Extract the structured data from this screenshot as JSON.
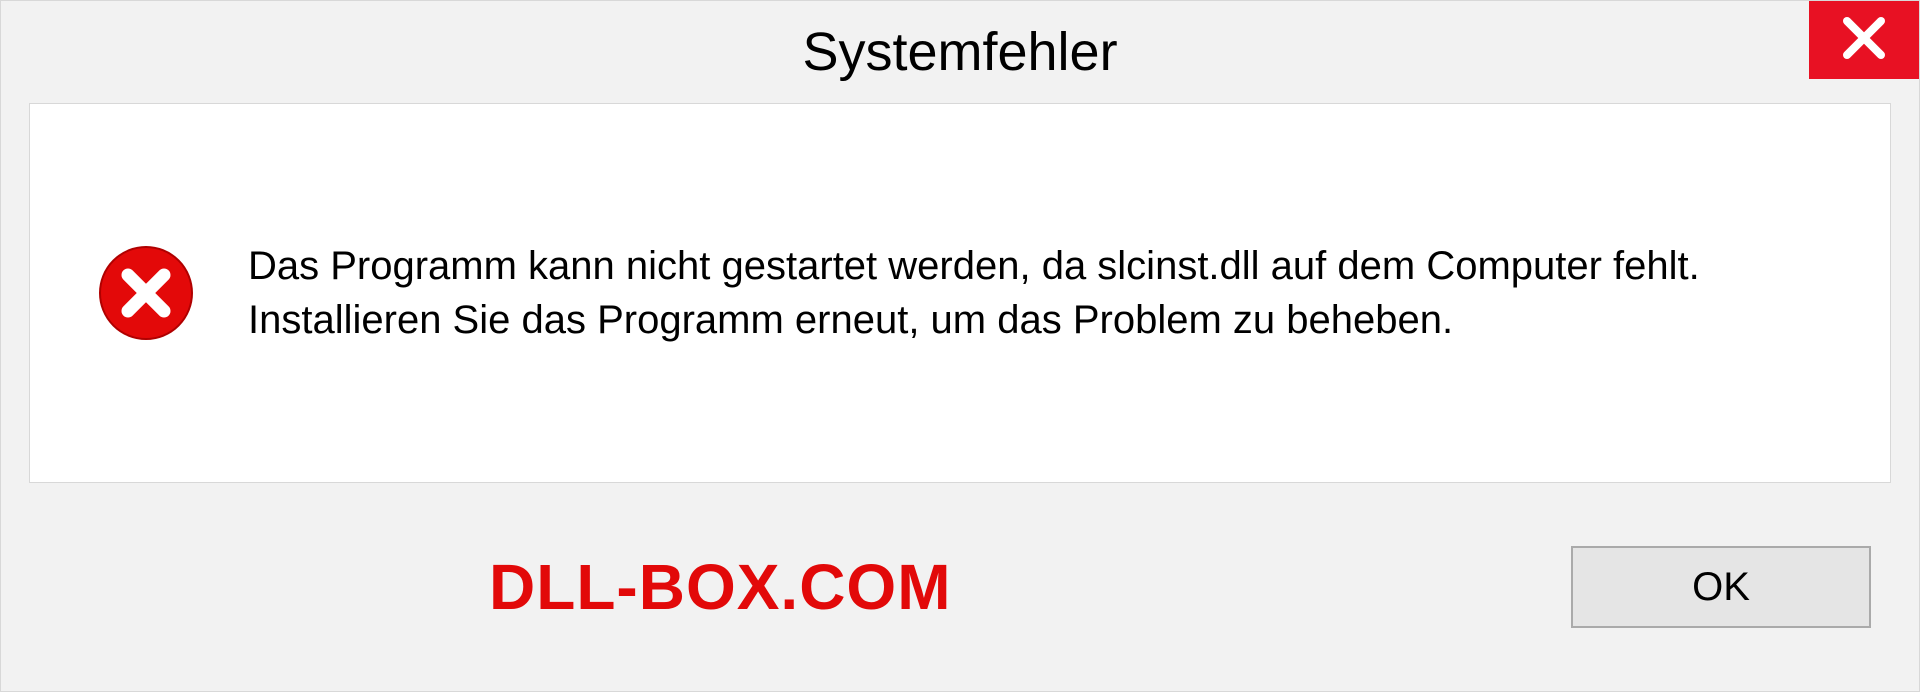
{
  "dialog": {
    "title": "Systemfehler",
    "message": "Das Programm kann nicht gestartet werden, da slcinst.dll auf dem Computer fehlt. Installieren Sie das Programm erneut, um das Problem zu beheben.",
    "ok_label": "OK"
  },
  "watermark": "DLL-BOX.COM"
}
